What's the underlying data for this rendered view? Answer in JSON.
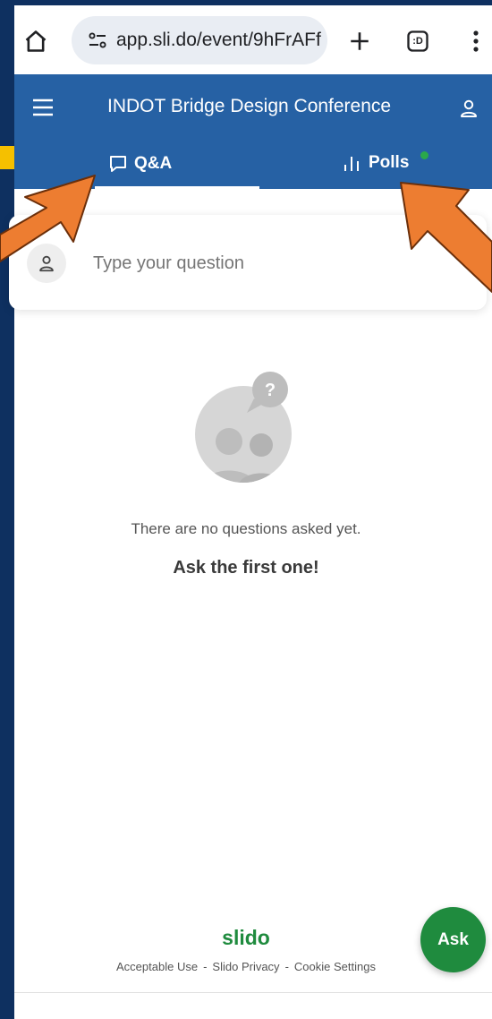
{
  "browser": {
    "url": "app.sli.do/event/9hFrAFf",
    "tab_count_label": ":D"
  },
  "header": {
    "event_title": "INDOT Bridge Design Conference",
    "tabs": [
      {
        "label": "Q&A",
        "active": true
      },
      {
        "label": "Polls",
        "active": false,
        "has_notification": true
      }
    ]
  },
  "question_card": {
    "placeholder": "Type your question"
  },
  "empty_state": {
    "message": "There are no questions asked yet.",
    "cta": "Ask the first one!"
  },
  "footer": {
    "logo": "slido",
    "links": [
      "Acceptable Use",
      "Slido Privacy",
      "Cookie Settings"
    ],
    "separator": "-"
  },
  "ask_button": {
    "label": "Ask"
  },
  "colors": {
    "header_bg": "#2661a4",
    "brand_green": "#1f8b3e",
    "slide_bg": "#0e3060",
    "arrow": "#ed7d31",
    "notification_dot": "#2aa84a"
  },
  "icons": [
    "home-icon",
    "site-settings-icon",
    "new-tab-icon",
    "tab-switcher-icon",
    "more-options-icon",
    "menu-icon",
    "profile-icon",
    "chat-bubble-icon",
    "bar-chart-icon",
    "user-icon"
  ]
}
